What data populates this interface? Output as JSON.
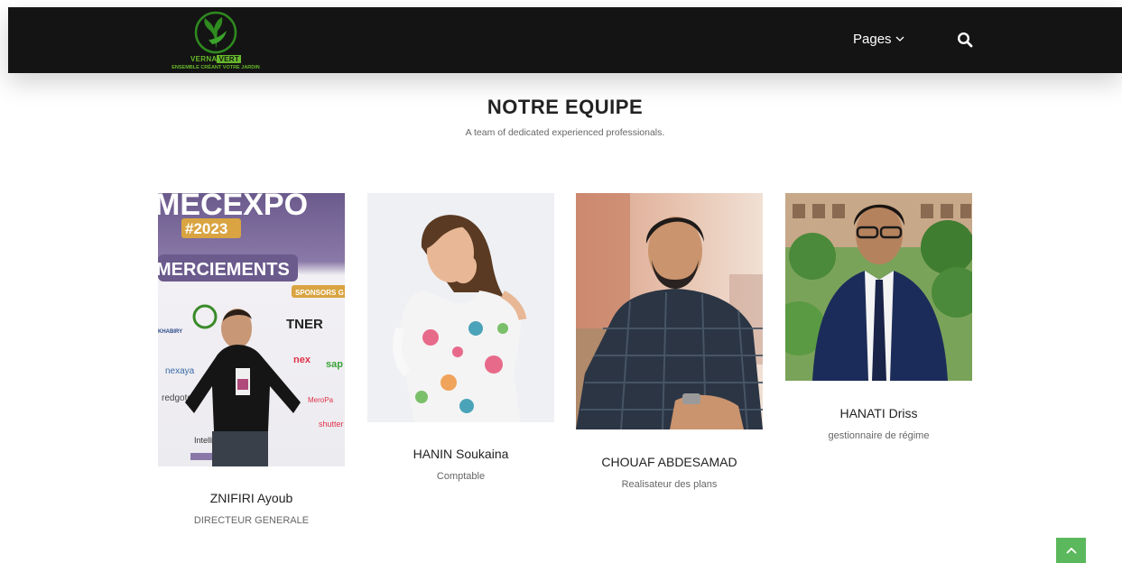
{
  "header": {
    "logo": {
      "brand_part1": "VERNA",
      "brand_part2": "VERT",
      "tagline": "ENSEMBLE CRÉANT VOTRE JARDIN"
    },
    "nav": {
      "pages_label": "Pages",
      "search_icon": "search-icon"
    }
  },
  "team": {
    "title": "NOTRE EQUIPE",
    "subtitle": "A team of dedicated experienced professionals.",
    "members": [
      {
        "name": "ZNIFIRI Ayoub",
        "role": "DIRECTEUR GENERALE",
        "photo_texts": [
          "MECEXPO",
          "#2023",
          "MERCIEMENTS",
          "SPONSORS G",
          "TNER",
          "KHABIRY",
          "nexaya",
          "redgoto",
          "shutter",
          "Intelli",
          "sap"
        ]
      },
      {
        "name": "HANIN Soukaina",
        "role": "Comptable"
      },
      {
        "name": "CHOUAF ABDESAMAD",
        "role": "Realisateur des plans"
      },
      {
        "name": "HANATI Driss",
        "role": "gestionnaire de régime"
      }
    ]
  },
  "colors": {
    "navbar": "#141414",
    "accent_green": "#5cb85c",
    "logo_green": "#67b82a"
  }
}
